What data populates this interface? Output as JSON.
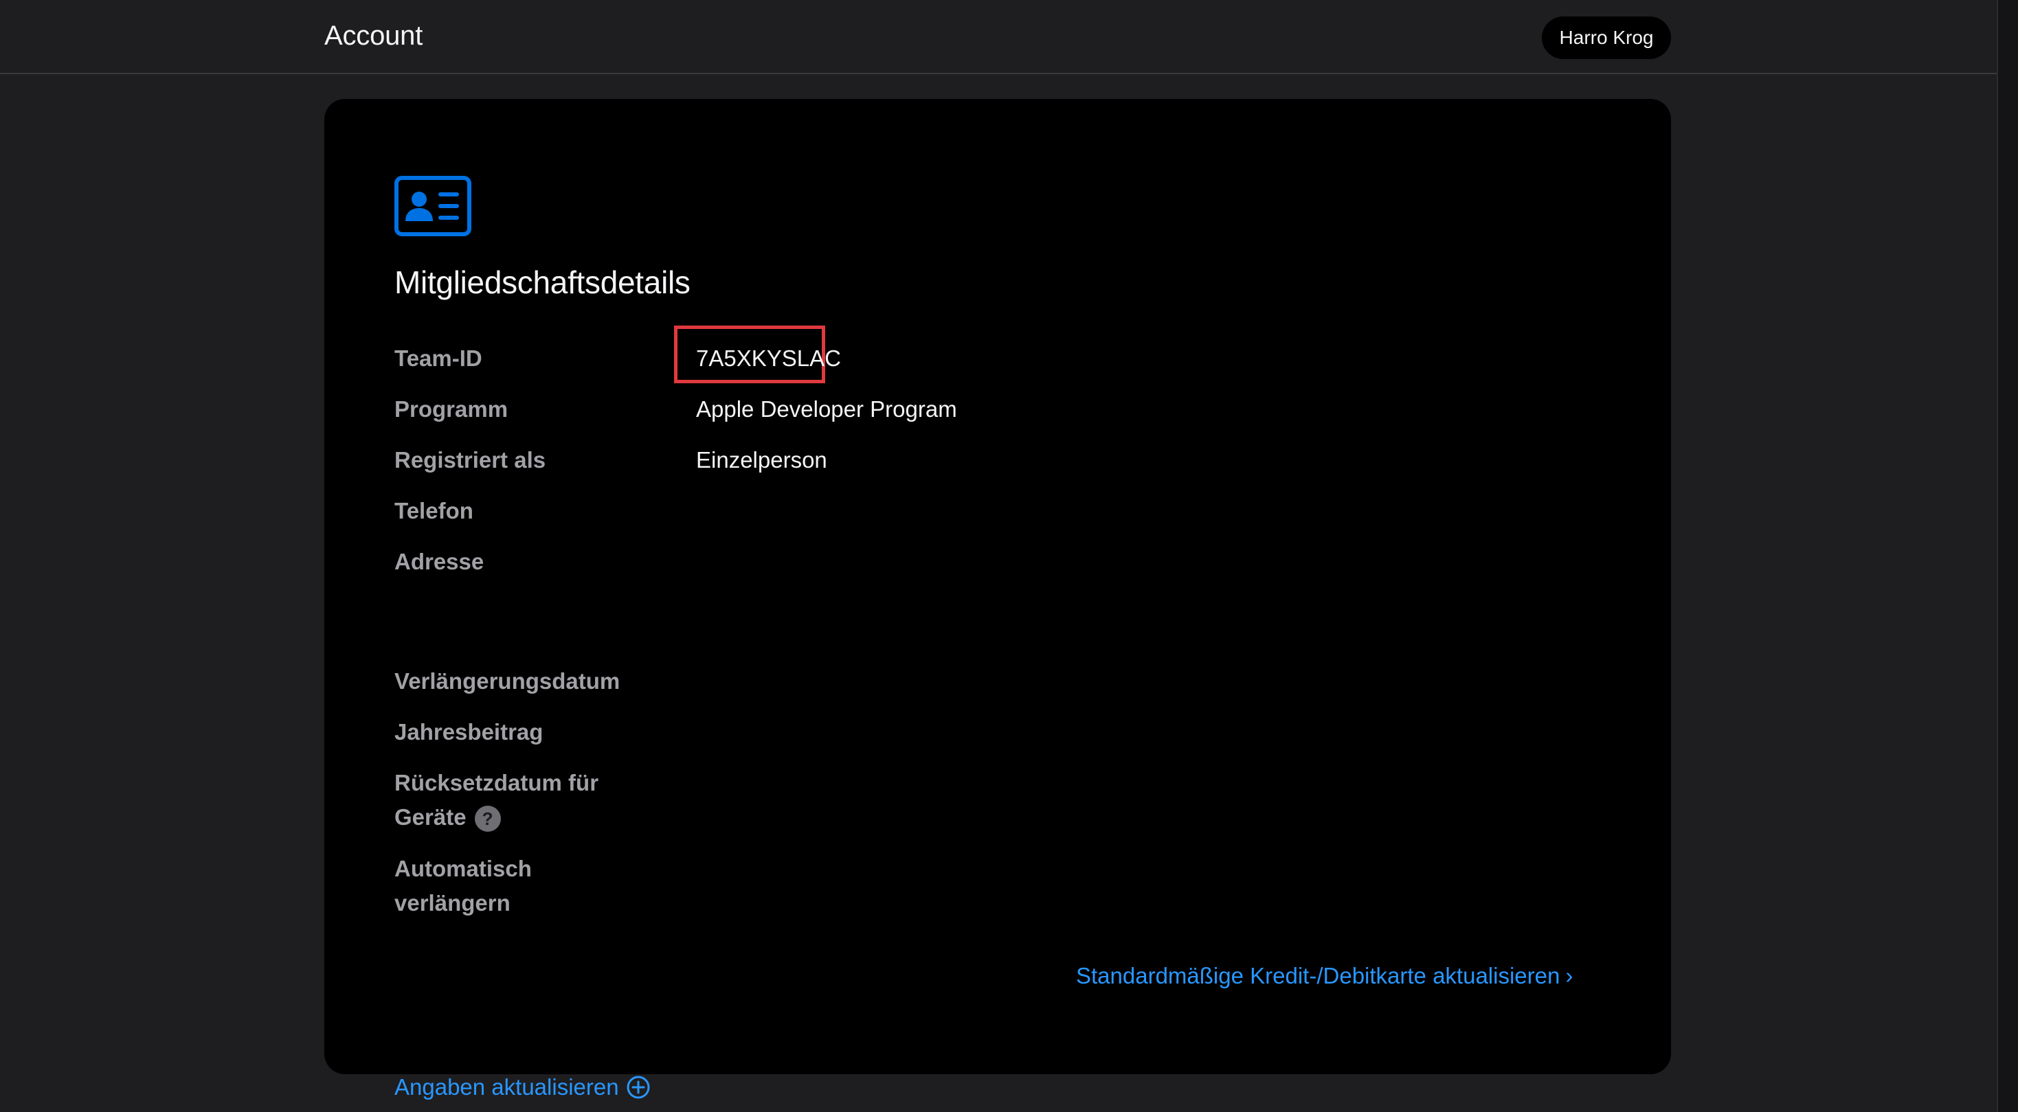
{
  "header": {
    "title": "Account",
    "user_name": "Harro Krog"
  },
  "membership": {
    "icon": "id-card-icon",
    "heading": "Mitgliedschaftsdetails",
    "fields": [
      {
        "label": "Team-ID",
        "value": "7A5XKYSLAC"
      },
      {
        "label": "Programm",
        "value": "Apple Developer Program"
      },
      {
        "label": "Registriert als",
        "value": "Einzelperson"
      },
      {
        "label": "Telefon",
        "value": ""
      },
      {
        "label": "Adresse",
        "value": ""
      },
      {
        "label": "Verlängerungsdatum",
        "value": ""
      },
      {
        "label": "Jahresbeitrag",
        "value": ""
      },
      {
        "label_line1": "Rücksetzdatum für",
        "label_line2": "Geräte",
        "help": "?",
        "value": ""
      },
      {
        "label_line1": "Automatisch",
        "label_line2": "verlängern",
        "value": ""
      }
    ],
    "update_card_link": "Standardmäßige Kredit-/Debitkarte aktualisieren",
    "update_card_chevron": "›",
    "update_info_link": "Angaben aktualisieren"
  },
  "colors": {
    "background": "#1e1e20",
    "card": "#000000",
    "accent_link": "#2997ff",
    "icon_blue": "#0071e3",
    "highlight_red": "#e0393e"
  }
}
